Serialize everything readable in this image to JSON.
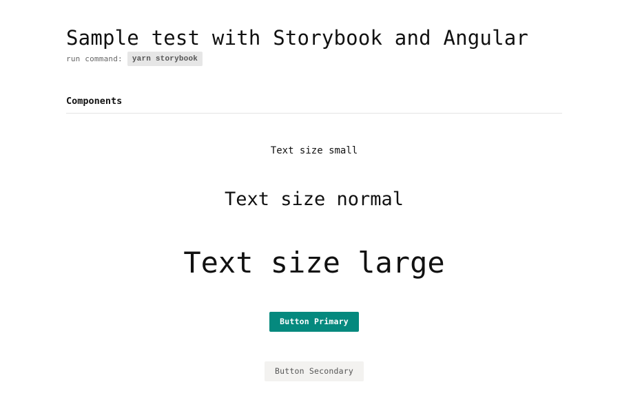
{
  "header": {
    "title": "Sample test with Storybook and Angular",
    "run_label": "run command:",
    "run_command": "yarn storybook"
  },
  "components": {
    "heading": "Components",
    "text_small": "Text size small",
    "text_normal": "Text size normal",
    "text_large": "Text size large",
    "button_primary": "Button Primary",
    "button_secondary": "Button Secondary"
  },
  "colors": {
    "primary_button_bg": "#05897e",
    "secondary_button_bg": "#f3f2f0",
    "code_bg": "#e6e6e6"
  }
}
